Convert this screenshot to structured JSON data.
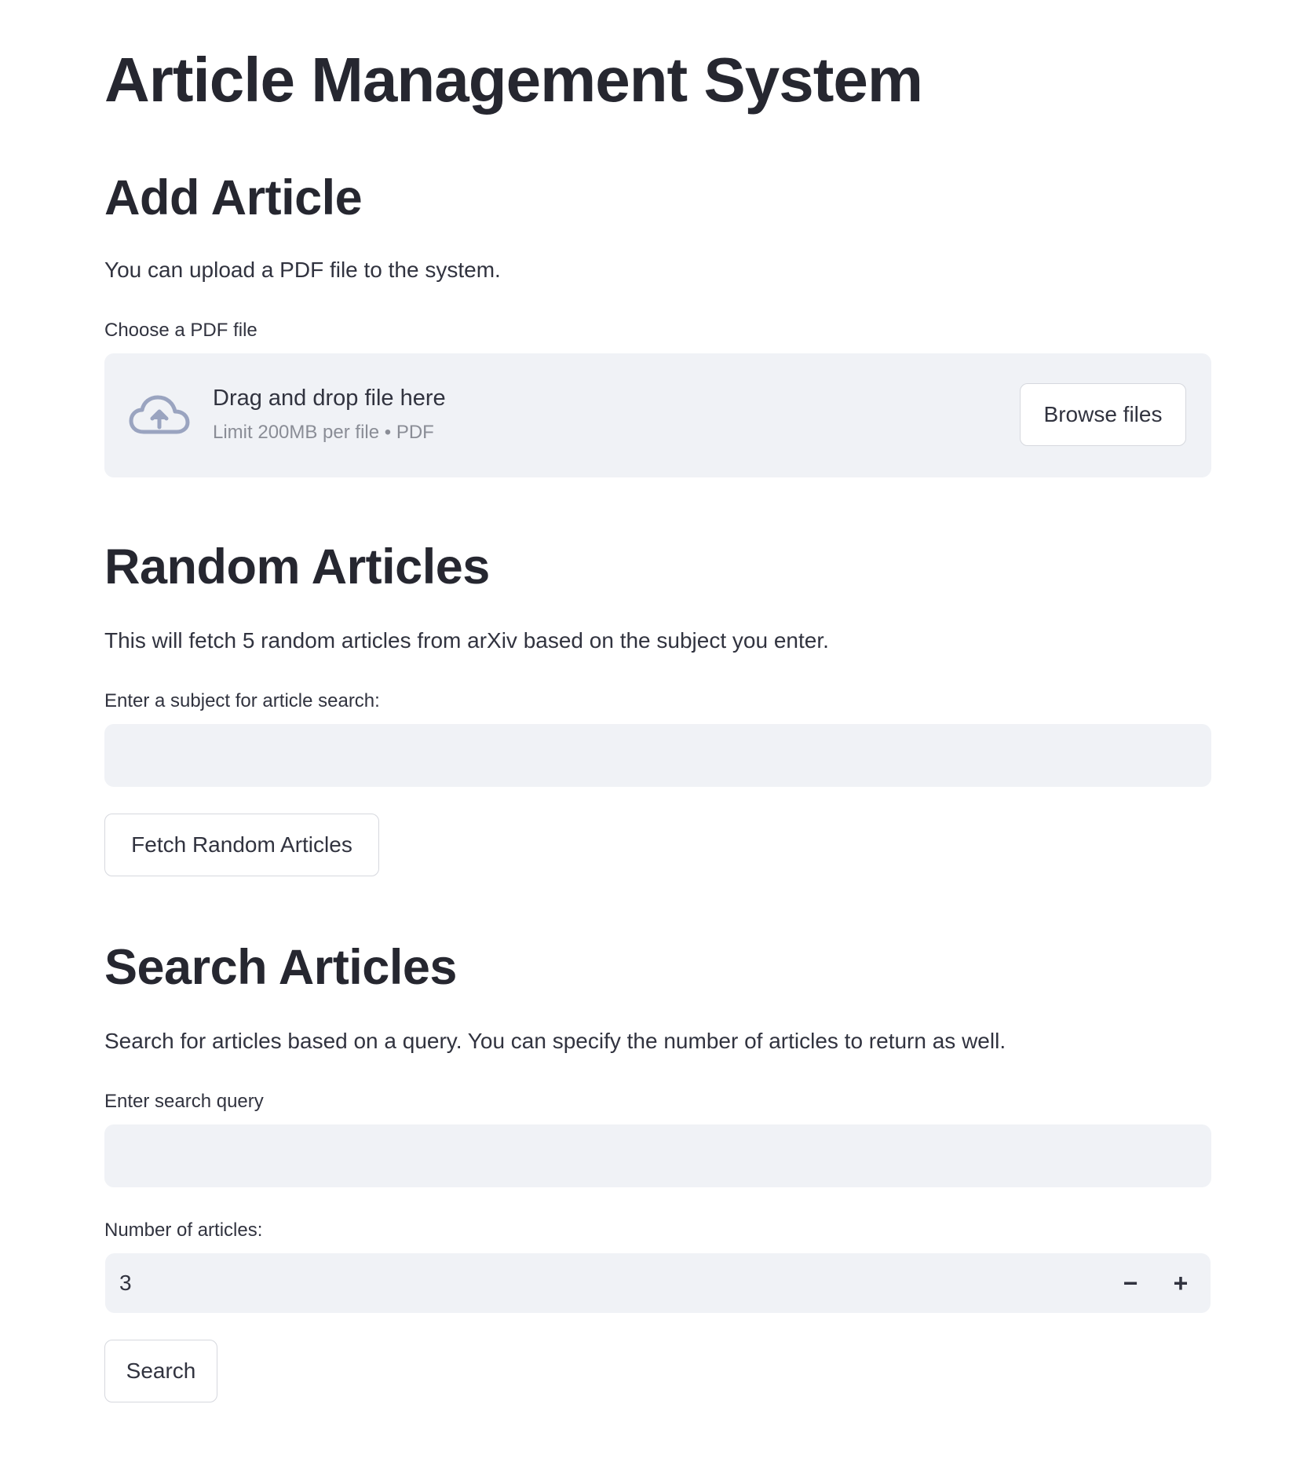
{
  "page": {
    "title": "Article Management System"
  },
  "add_article": {
    "heading": "Add Article",
    "description": "You can upload a PDF file to the system.",
    "file_label": "Choose a PDF file",
    "drop_title": "Drag and drop file here",
    "drop_limit": "Limit 200MB per file • PDF",
    "browse_label": "Browse files",
    "icon": "cloud-upload-icon"
  },
  "random_articles": {
    "heading": "Random Articles",
    "description": "This will fetch 5 random articles from arXiv based on the subject you enter.",
    "subject_label": "Enter a subject for article search:",
    "subject_value": "",
    "fetch_label": "Fetch Random Articles"
  },
  "search_articles": {
    "heading": "Search Articles",
    "description": "Search for articles based on a query. You can specify the number of articles to return as well.",
    "query_label": "Enter search query",
    "query_value": "",
    "count_label": "Number of articles:",
    "count_value": "3",
    "minus_label": "−",
    "plus_label": "+",
    "search_label": "Search"
  },
  "colors": {
    "input_background": "#f0f2f6",
    "text": "#31333f",
    "heading": "#262730",
    "muted": "#8a8d96"
  }
}
